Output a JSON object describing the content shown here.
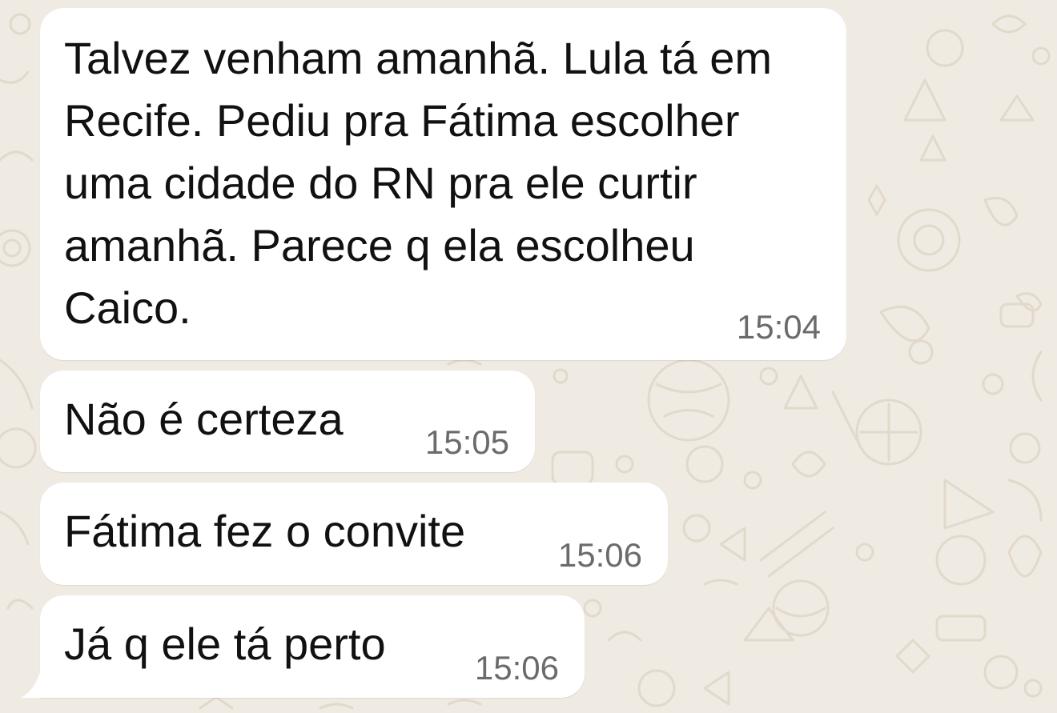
{
  "theme": {
    "wallpaper_color": "#efeae2",
    "doodle_color": "#e2d9cb",
    "bubble_color": "#ffffff",
    "text_color": "#111111",
    "time_color": "#6b6b6b"
  },
  "messages": [
    {
      "text": "Talvez venham amanhã. Lula tá em\nRecife. Pediu pra Fátima escolher\numa cidade do RN pra ele curtir\namanhã. Parece q ela escolheu\nCaico.",
      "time": "15:04",
      "direction": "incoming"
    },
    {
      "text": "Não é certeza",
      "time": "15:05",
      "direction": "incoming"
    },
    {
      "text": "Fátima fez o convite",
      "time": "15:06",
      "direction": "incoming"
    },
    {
      "text": "Já q ele tá perto",
      "time": "15:06",
      "direction": "incoming"
    }
  ]
}
